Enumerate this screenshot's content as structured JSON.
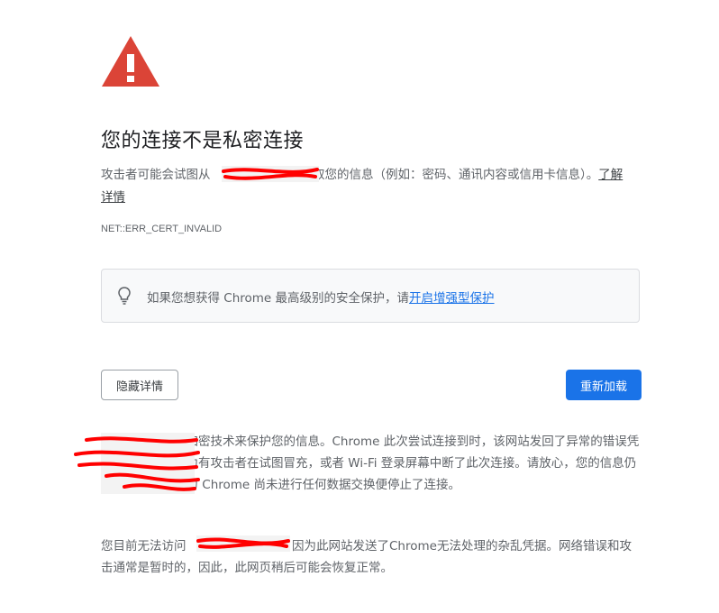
{
  "error": {
    "title": "您的连接不是私密连接",
    "desc_before": "攻击者可能会试图从",
    "desc_after": "窃取您的信息（例如：密码、通讯内容或信用卡信息）。",
    "learn_more": "了解详情",
    "code": "NET::ERR_CERT_INVALID"
  },
  "protection_tip": {
    "text": "如果您想获得 Chrome 最高级别的安全保护，请",
    "link": "开启增强型保护"
  },
  "buttons": {
    "hide_details": "隐藏详情",
    "reload": "重新加载"
  },
  "details": {
    "p1": "网站通常会使用加密技术来保护您的信息。Chrome 此次尝试连接到时，该网站发回了异常的错误凭据。这可能是因为有攻击者在试图冒充，或者 Wi-Fi 登录屏幕中断了此次连接。请放心，您的信息仍然是安全的，因为 Chrome 尚未进行任何数据交换便停止了连接。",
    "p2_before": "您目前无法访问",
    "p2_after": "，因为此网站发送了Chrome无法处理的杂乱凭据。网络错误和攻击通常是暂时的，因此，此网页稍后可能会恢复正常。"
  },
  "colors": {
    "warning": "#db4437",
    "link": "#1a73e8",
    "primary_button": "#1a73e8",
    "redaction": "#ff0000"
  },
  "icons": [
    "warning-icon",
    "lightbulb-icon"
  ]
}
